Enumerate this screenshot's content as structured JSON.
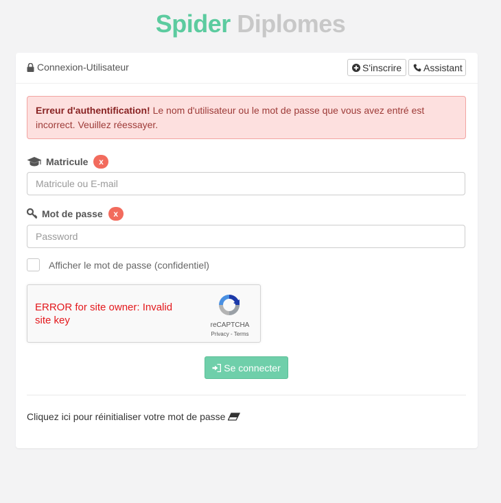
{
  "brand": {
    "part1": "Spider",
    "part2": "Diplomes"
  },
  "header": {
    "title": "Connexion-Utilisateur",
    "signup_label": "S'inscrire",
    "assistant_label": "Assistant"
  },
  "alert": {
    "strong": "Erreur d'authentification!",
    "message": " Le nom d'utilisateur ou le mot de passe que vous avez entré est incorrect. Veuillez réessayer."
  },
  "form": {
    "matricule_label": "Matricule",
    "matricule_placeholder": "Matricule ou E-mail",
    "password_label": "Mot de passe",
    "password_placeholder": "Password",
    "error_badge": "x",
    "show_password_label": "Afficher le mot de passe (confidentiel)",
    "submit_label": "Se connecter"
  },
  "captcha": {
    "error": "ERROR for site owner: Invalid site key",
    "brand": "reCAPTCHA",
    "links": "Privacy - Terms"
  },
  "reset_link": "Cliquez ici pour réinitialiser votre mot de passe",
  "colors": {
    "accent": "#5ccb9f",
    "muted_brand": "#c8c8c8",
    "error": "#f26b5d",
    "alert_bg": "#fde0df"
  }
}
